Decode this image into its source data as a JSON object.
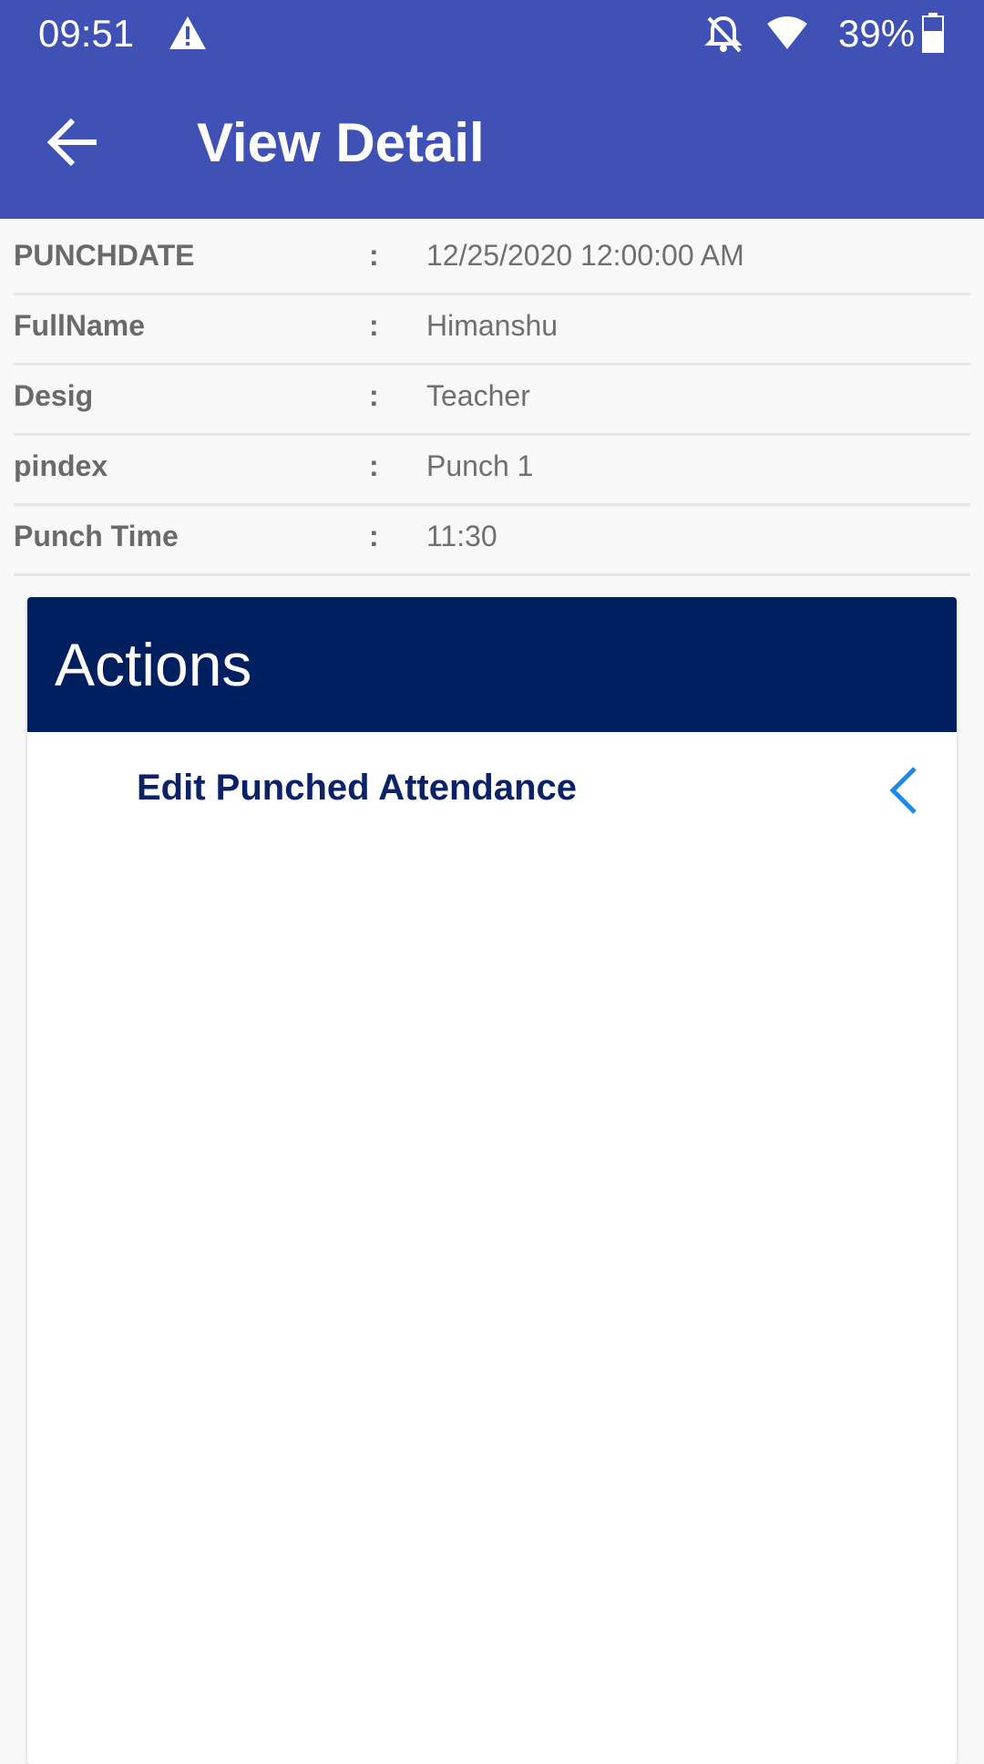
{
  "status_bar": {
    "time": "09:51",
    "battery": "39%",
    "icons": [
      "warning-icon",
      "bell-off-icon",
      "wifi-icon",
      "battery-icon"
    ]
  },
  "app_bar": {
    "back_icon": "arrow-back-icon",
    "title": "View Detail",
    "background_color": "#3f51b5"
  },
  "details": [
    {
      "label": "PUNCHDATE",
      "separator": ":",
      "value": "12/25/2020 12:00:00 AM"
    },
    {
      "label": "FullName",
      "separator": ":",
      "value": "Himanshu"
    },
    {
      "label": "Desig",
      "separator": ":",
      "value": "Teacher"
    },
    {
      "label": "pindex",
      "separator": ":",
      "value": "Punch 1"
    },
    {
      "label": "Punch Time",
      "separator": ":",
      "value": "11:30"
    }
  ],
  "actions": {
    "title": "Actions",
    "header_color": "#001f5e",
    "items": [
      {
        "label": "Edit Punched Attendance",
        "icon": "chevron-left-icon",
        "icon_color": "#1e88e5"
      }
    ]
  }
}
